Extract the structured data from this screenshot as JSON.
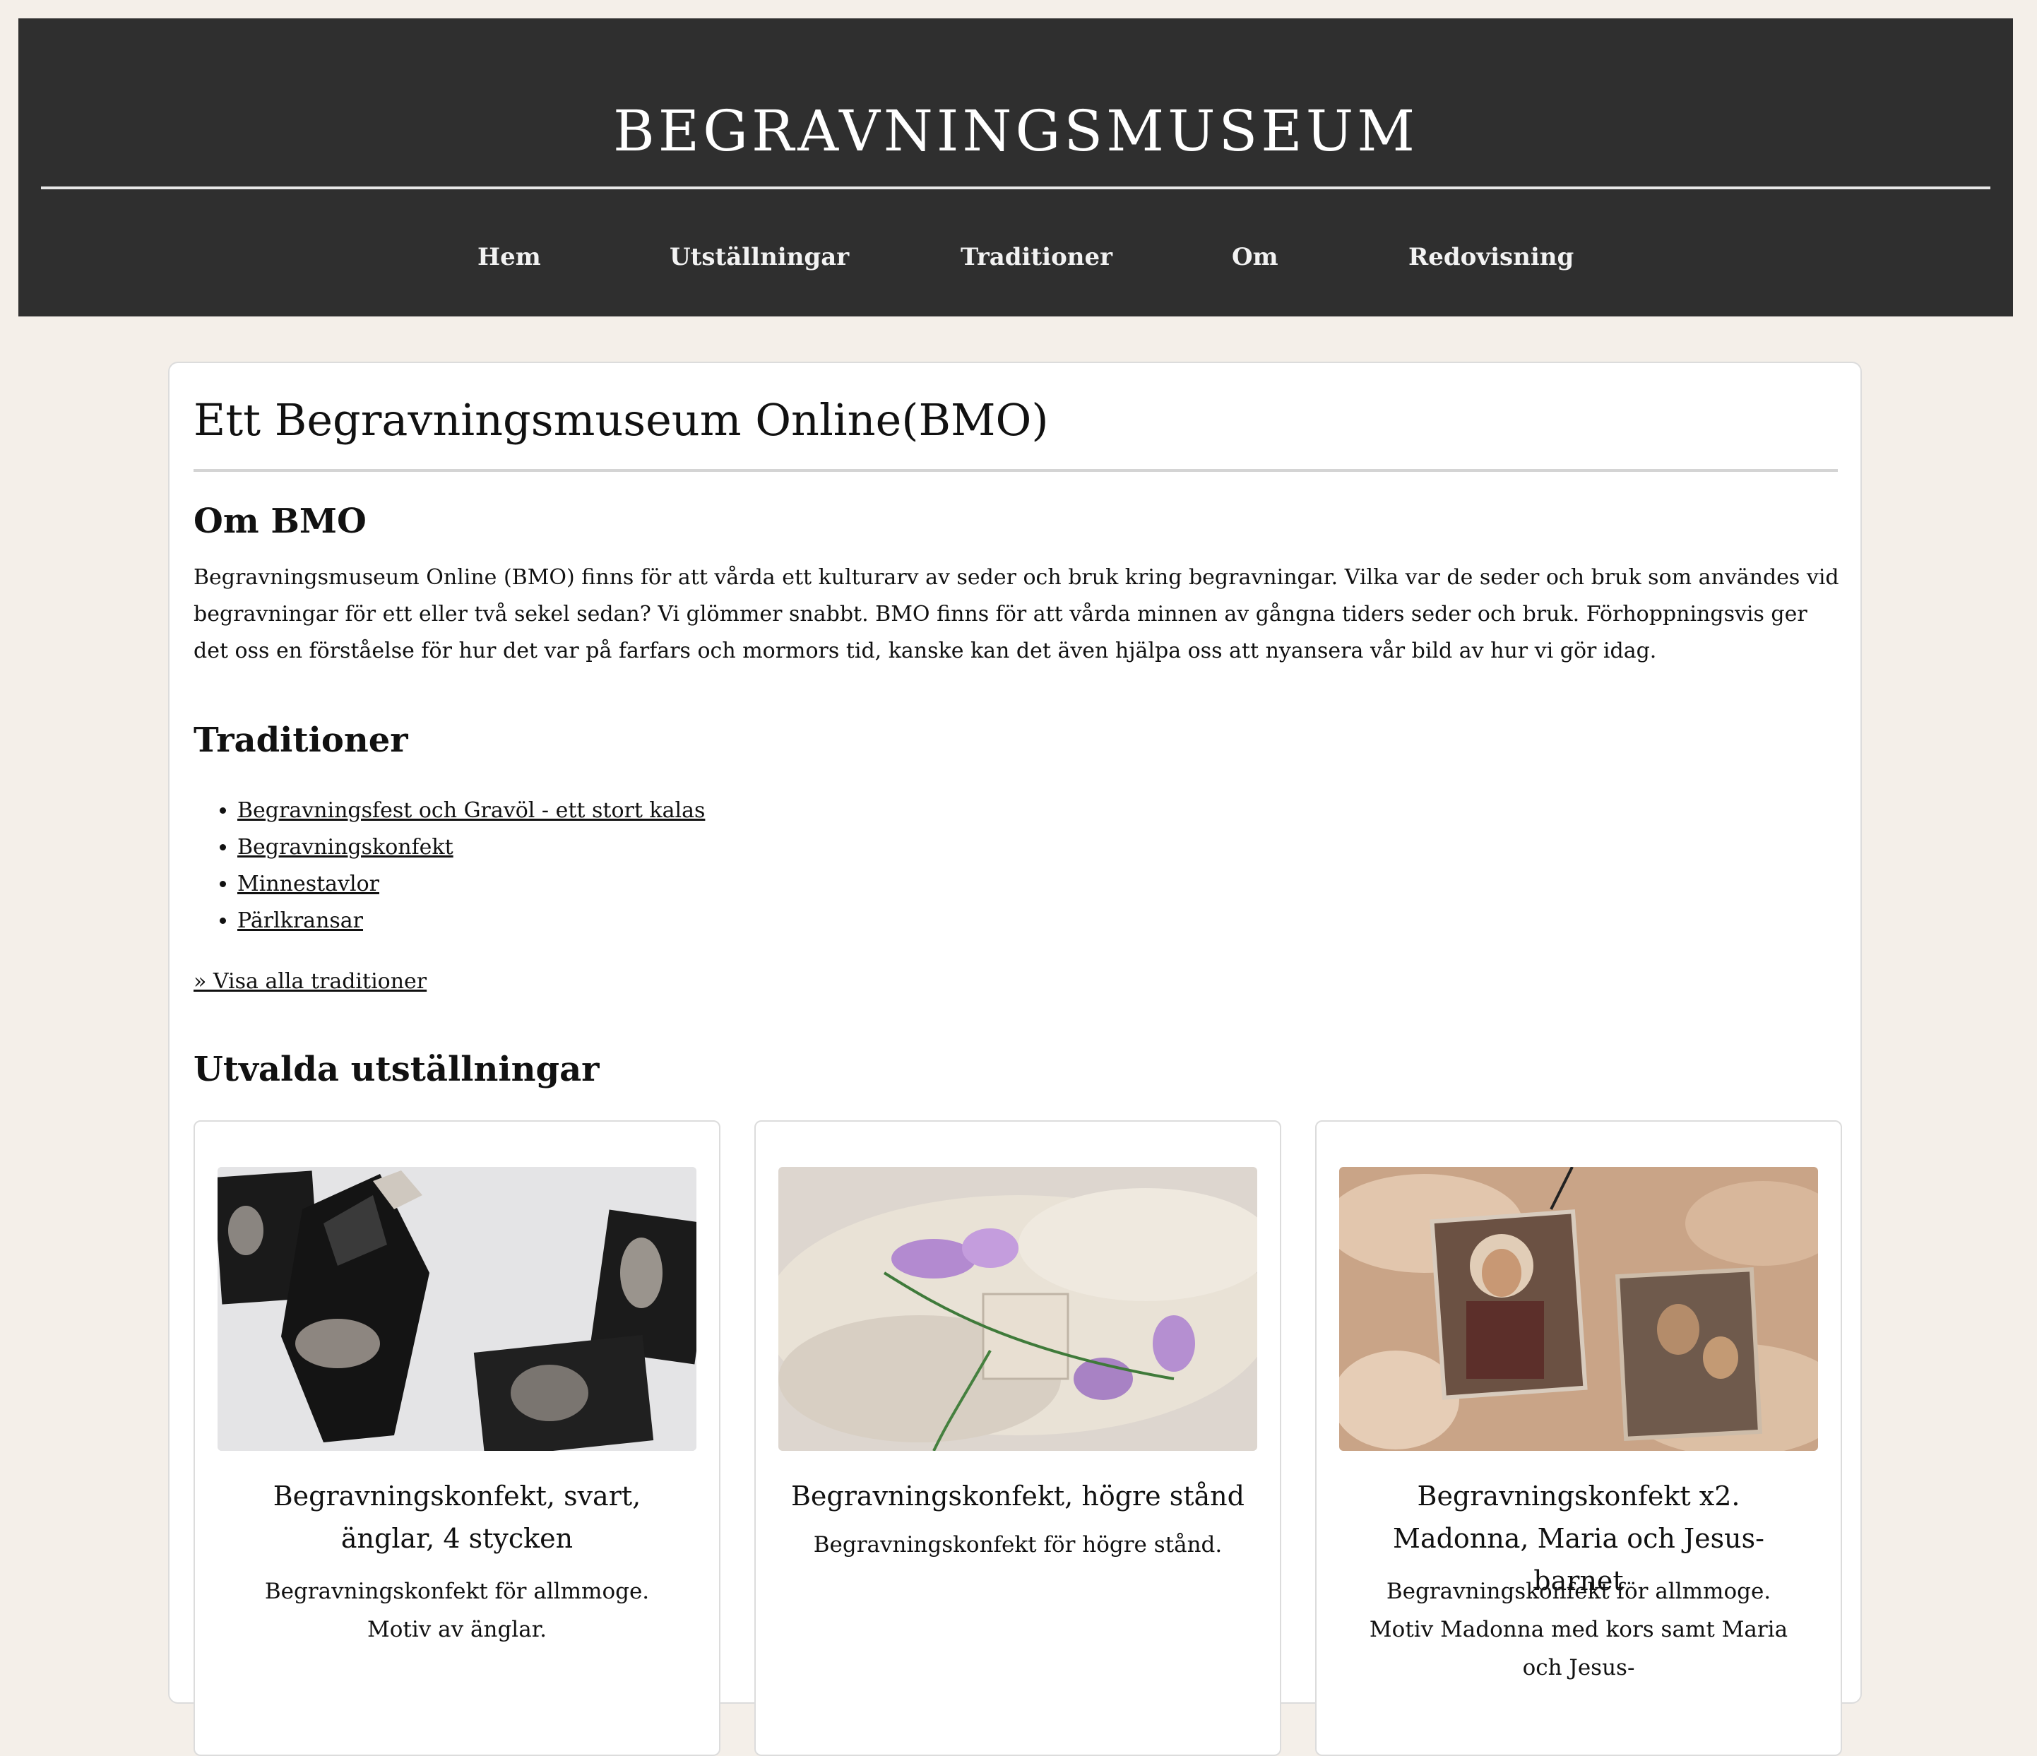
{
  "header": {
    "site_title": "BEGRAVNINGSMUSEUM",
    "nav": [
      "Hem",
      "Utställningar",
      "Traditioner",
      "Om",
      "Redovisning"
    ]
  },
  "main": {
    "page_title": "Ett Begravningsmuseum Online(BMO)",
    "about": {
      "heading": "Om BMO",
      "text": "Begravningsmuseum Online (BMO) finns för att vårda ett kulturarv av seder och bruk kring begravningar. Vilka var de seder och bruk som användes vid begravningar för ett eller två sekel sedan? Vi glömmer snabbt. BMO finns för att vårda minnen av gångna tiders seder och bruk. Förhoppningsvis ger det oss en förståelse för hur det var på farfars och mormors tid, kanske kan det även hjälpa oss att nyansera vår bild av hur vi gör idag."
    },
    "traditions": {
      "heading": "Traditioner",
      "items": [
        "Begravningsfest och Gravöl - ett stort kalas",
        "Begravningskonfekt",
        "Minnestavlor",
        "Pärlkransar"
      ],
      "all_link": "» Visa alla traditioner"
    },
    "exhibitions": {
      "heading": "Utvalda utställningar",
      "items": [
        {
          "title": "Begravningskonfekt, svart, änglar, 4 stycken",
          "description": "Begravningskonfekt för allmmoge. Motiv av änglar."
        },
        {
          "title": "Begravningskonfekt, högre stånd",
          "description": "Begravningskonfekt för högre stånd."
        },
        {
          "title": "Begravningskonfekt x2. Madonna, Maria och Jesus-barnet",
          "description": "Begravningskonfekt för allmmoge. Motiv Madonna med kors samt Maria och Jesus-"
        }
      ]
    }
  }
}
